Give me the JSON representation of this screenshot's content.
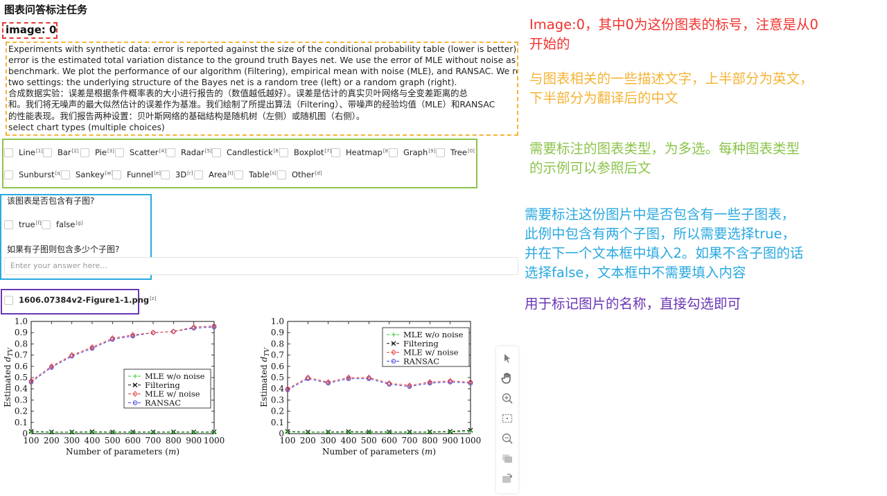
{
  "page": {
    "title": "图表问答标注任务",
    "image_label": "image: 0"
  },
  "description": {
    "lines": [
      "Experiments with synthetic data: error is reported against the size of the conditional probability table (lower is better). The",
      "error is the estimated total variation distance to the ground truth Bayes net. We use the error of MLE without noise as our",
      "benchmark. We plot the performance of our algorithm (Filtering), empirical mean with noise (MLE), and RANSAC. We report",
      "two settings: the underlying structure of the Bayes net is a random tree (left) or a random graph (right).",
      "合成数据实验：误差是根据条件概率表的大小进行报告的（数值越低越好）。误差是估计的真实贝叶网络与全变差距离的总",
      "和。我们将无噪声的最大似然估计的误差作为基准。我们绘制了所提出算法（Filtering）、带噪声的经验均值（MLE）和RANSAC",
      "的性能表现。我们报告两种设置：贝叶斯网络的基础结构是随机树（左侧）或随机图（右侧）。",
      "select chart types (multiple choices)"
    ]
  },
  "chart_types": [
    {
      "label": "Line",
      "key": "[1]"
    },
    {
      "label": "Bar",
      "key": "[2]"
    },
    {
      "label": "Pie",
      "key": "[3]"
    },
    {
      "label": "Scatter",
      "key": "[4]"
    },
    {
      "label": "Radar",
      "key": "[5]"
    },
    {
      "label": "Candlestick",
      "key": "[6]"
    },
    {
      "label": "Boxplot",
      "key": "[7]"
    },
    {
      "label": "Heatmap",
      "key": "[8]"
    },
    {
      "label": "Graph",
      "key": "[9]"
    },
    {
      "label": "Tree",
      "key": "[0]"
    },
    {
      "label": "Sunburst",
      "key": "[q]"
    },
    {
      "label": "Sankey",
      "key": "[w]"
    },
    {
      "label": "Funnel",
      "key": "[e]"
    },
    {
      "label": "3D",
      "key": "[r]"
    },
    {
      "label": "Area",
      "key": "[t]"
    },
    {
      "label": "Table",
      "key": "[s]"
    },
    {
      "label": "Other",
      "key": "[d]"
    }
  ],
  "subplot": {
    "question": "该图表是否包含有子图?",
    "options": [
      {
        "label": "true",
        "key": "[f]"
      },
      {
        "label": "false",
        "key": "[g]"
      }
    ],
    "count_question": "如果有子图则包含多少个子图?",
    "answer_placeholder": "Enter your answer here..."
  },
  "file": {
    "label": "1606.07384v2-Figure1-1.png",
    "key": "[z]"
  },
  "annotations": {
    "red": [
      "Image:0，其中0为这份图表的标号，注意是从0",
      "开始的"
    ],
    "orange": [
      "与图表相关的一些描述文字，上半部分为英文，",
      "下半部分为翻译后的中文"
    ],
    "green": [
      "需要标注的图表类型，为多选。每种图表类型",
      "的示例可以参照后文"
    ],
    "blue": [
      "需要标注这份图片中是否包含有一些子图表，",
      "此例中包含有两个子图，所以需要选择true，",
      "并在下一个文本框中填入2。如果不含子图的话",
      "选择false，文本框中不需要填入内容"
    ],
    "purple": [
      "用于标记图片的名称，直接勾选即可"
    ]
  },
  "colors": {
    "red": "#f0322d",
    "orange": "#f5b335",
    "green": "#8bc34a",
    "blue": "#29a8e0",
    "purple": "#6a35b5"
  },
  "toolbar": [
    "pointer-icon",
    "hand-icon",
    "zoom-in-icon",
    "fit-screen-icon",
    "zoom-out-icon",
    "layers-icon",
    "rotate-icon"
  ],
  "chart_data": [
    {
      "type": "line",
      "xlabel": "Number of parameters (m)",
      "ylabel": "Estimated d_TV",
      "xlim": [
        100,
        1000
      ],
      "ylim": [
        0,
        1.0
      ],
      "x_ticks": [
        "100",
        "200",
        "300",
        "400",
        "500",
        "600",
        "700",
        "800",
        "900",
        "1000"
      ],
      "y_ticks": [
        "0",
        "0.1",
        "0.2",
        "0.3",
        "0.4",
        "0.5",
        "0.6",
        "0.7",
        "0.8",
        "0.9",
        "1.0"
      ],
      "legend": "center-right",
      "x": [
        100,
        200,
        300,
        400,
        500,
        600,
        700,
        800,
        900,
        1000
      ],
      "series": [
        {
          "name": "MLE w/o noise",
          "color": "#2ecc2e",
          "dash": "4,3",
          "marker": "plus",
          "values": [
            0.015,
            0.012,
            0.012,
            0.013,
            0.012,
            0.012,
            0.012,
            0.012,
            0.012,
            0.012
          ]
        },
        {
          "name": "Filtering",
          "color": "#111111",
          "dash": "4,3",
          "marker": "x",
          "values": [
            0.02,
            0.015,
            0.015,
            0.017,
            0.015,
            0.016,
            0.015,
            0.016,
            0.015,
            0.016
          ]
        },
        {
          "name": "MLE w/ noise",
          "color": "#e53935",
          "dash": "4,3",
          "marker": "diamond",
          "values": [
            0.47,
            0.6,
            0.7,
            0.77,
            0.85,
            0.88,
            0.9,
            0.91,
            0.95,
            0.96
          ]
        },
        {
          "name": "RANSAC",
          "color": "#3f3fd8",
          "dash": "4,3",
          "marker": "circle",
          "values": [
            0.46,
            0.59,
            0.69,
            0.76,
            0.84,
            0.87,
            0.9,
            0.91,
            0.94,
            0.95
          ]
        }
      ]
    },
    {
      "type": "line",
      "xlabel": "Number of parameters (m)",
      "ylabel": "Estimated d_TV",
      "xlim": [
        100,
        1000
      ],
      "ylim": [
        0,
        1.0
      ],
      "x_ticks": [
        "100",
        "200",
        "300",
        "400",
        "500",
        "600",
        "700",
        "800",
        "900",
        "1000"
      ],
      "y_ticks": [
        "0",
        "0.1",
        "0.2",
        "0.3",
        "0.4",
        "0.5",
        "0.6",
        "0.7",
        "0.8",
        "0.9",
        "1.0"
      ],
      "legend": "top-right",
      "x": [
        100,
        200,
        300,
        400,
        500,
        600,
        700,
        800,
        900,
        1000
      ],
      "series": [
        {
          "name": "MLE w/o noise",
          "color": "#2ecc2e",
          "dash": "4,3",
          "marker": "plus",
          "values": [
            0.015,
            0.012,
            0.012,
            0.013,
            0.012,
            0.012,
            0.012,
            0.012,
            0.015,
            0.02
          ]
        },
        {
          "name": "Filtering",
          "color": "#111111",
          "dash": "4,3",
          "marker": "x",
          "values": [
            0.02,
            0.015,
            0.015,
            0.018,
            0.016,
            0.016,
            0.015,
            0.016,
            0.02,
            0.03
          ]
        },
        {
          "name": "MLE w/ noise",
          "color": "#e53935",
          "dash": "4,3",
          "marker": "diamond",
          "values": [
            0.4,
            0.5,
            0.46,
            0.5,
            0.5,
            0.45,
            0.43,
            0.46,
            0.47,
            0.46
          ]
        },
        {
          "name": "RANSAC",
          "color": "#3f3fd8",
          "dash": "4,3",
          "marker": "circle",
          "values": [
            0.39,
            0.49,
            0.45,
            0.49,
            0.49,
            0.44,
            0.42,
            0.45,
            0.46,
            0.45
          ]
        }
      ]
    }
  ]
}
